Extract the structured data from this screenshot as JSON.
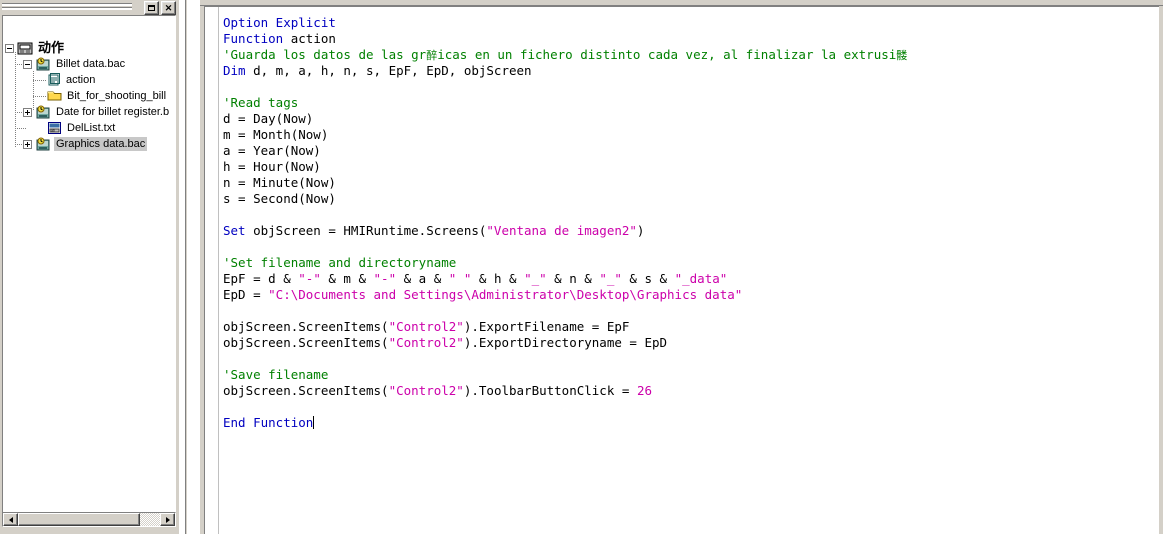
{
  "tree_window": {
    "titlebar": {
      "maximize_label": "□",
      "close_label": "✕"
    },
    "root": {
      "label": "动作",
      "icon": "action-script-icon",
      "expander": "minus"
    },
    "items": [
      {
        "label": "Billet data.bac",
        "icon": "bac-file-icon",
        "expander": "minus",
        "depth": 1,
        "selected": false
      },
      {
        "label": "action",
        "icon": "function-icon",
        "expander": "none",
        "depth": 2,
        "selected": false
      },
      {
        "label": "Bit_for_shooting_bill",
        "icon": "folder-icon",
        "expander": "none",
        "depth": 2,
        "selected": false
      },
      {
        "label": "Date for billet register.b",
        "icon": "bac-file-icon",
        "expander": "plus",
        "depth": 1,
        "selected": false
      },
      {
        "label": "DelList.txt",
        "icon": "text-file-icon",
        "expander": "none",
        "depth": 1,
        "selected": false
      },
      {
        "label": "Graphics data.bac",
        "icon": "bac-file-icon",
        "expander": "plus",
        "depth": 1,
        "selected": true
      }
    ],
    "hscrollbar": {
      "left_arrow": "◄",
      "right_arrow": "►"
    }
  },
  "editor": {
    "lines": [
      {
        "segments": [
          {
            "t": "Option Explicit",
            "c": "kw"
          }
        ]
      },
      {
        "segments": [
          {
            "t": "Function",
            "c": "kw"
          },
          {
            "t": " action",
            "c": ""
          }
        ]
      },
      {
        "segments": [
          {
            "t": "'Guarda los datos de las gr",
            "c": "cm"
          },
          {
            "t": "醉",
            "c": "mojibake"
          },
          {
            "t": "icas en un fichero distinto cada vez, al finalizar la extrusi",
            "c": "cm"
          },
          {
            "t": "髅",
            "c": "mojibake"
          }
        ]
      },
      {
        "segments": [
          {
            "t": "Dim",
            "c": "kw"
          },
          {
            "t": " d, m, a, h, n, s, EpF, EpD, objScreen",
            "c": ""
          }
        ]
      },
      {
        "segments": []
      },
      {
        "segments": [
          {
            "t": "'Read tags",
            "c": "cm"
          }
        ]
      },
      {
        "segments": [
          {
            "t": "d = Day(Now)",
            "c": ""
          }
        ]
      },
      {
        "segments": [
          {
            "t": "m = Month(Now)",
            "c": ""
          }
        ]
      },
      {
        "segments": [
          {
            "t": "a = Year(Now)",
            "c": ""
          }
        ]
      },
      {
        "segments": [
          {
            "t": "h = Hour(Now)",
            "c": ""
          }
        ]
      },
      {
        "segments": [
          {
            "t": "n = Minute(Now)",
            "c": ""
          }
        ]
      },
      {
        "segments": [
          {
            "t": "s = Second(Now)",
            "c": ""
          }
        ]
      },
      {
        "segments": []
      },
      {
        "segments": [
          {
            "t": "Set",
            "c": "kw"
          },
          {
            "t": " objScreen = HMIRuntime.Screens(",
            "c": ""
          },
          {
            "t": "\"Ventana de imagen2\"",
            "c": "str"
          },
          {
            "t": ")",
            "c": ""
          }
        ]
      },
      {
        "segments": []
      },
      {
        "segments": [
          {
            "t": "'Set filename and directoryname",
            "c": "cm"
          }
        ]
      },
      {
        "segments": [
          {
            "t": "EpF = d & ",
            "c": ""
          },
          {
            "t": "\"-\"",
            "c": "str"
          },
          {
            "t": " & m & ",
            "c": ""
          },
          {
            "t": "\"-\"",
            "c": "str"
          },
          {
            "t": " & a & ",
            "c": ""
          },
          {
            "t": "\" \"",
            "c": "str"
          },
          {
            "t": " & h & ",
            "c": ""
          },
          {
            "t": "\"_\"",
            "c": "str"
          },
          {
            "t": " & n & ",
            "c": ""
          },
          {
            "t": "\"_\"",
            "c": "str"
          },
          {
            "t": " & s & ",
            "c": ""
          },
          {
            "t": "\"_data\"",
            "c": "str"
          }
        ]
      },
      {
        "segments": [
          {
            "t": "EpD = ",
            "c": ""
          },
          {
            "t": "\"C:\\Documents and Settings\\Administrator\\Desktop\\Graphics data\"",
            "c": "str"
          }
        ]
      },
      {
        "segments": []
      },
      {
        "segments": [
          {
            "t": "objScreen.ScreenItems(",
            "c": ""
          },
          {
            "t": "\"Control2\"",
            "c": "str"
          },
          {
            "t": ").ExportFilename = EpF",
            "c": ""
          }
        ]
      },
      {
        "segments": [
          {
            "t": "objScreen.ScreenItems(",
            "c": ""
          },
          {
            "t": "\"Control2\"",
            "c": "str"
          },
          {
            "t": ").ExportDirectoryname = EpD",
            "c": ""
          }
        ]
      },
      {
        "segments": []
      },
      {
        "segments": [
          {
            "t": "'Save filename",
            "c": "cm"
          }
        ]
      },
      {
        "segments": [
          {
            "t": "objScreen.ScreenItems(",
            "c": ""
          },
          {
            "t": "\"Control2\"",
            "c": "str"
          },
          {
            "t": ").ToolbarButtonClick = ",
            "c": ""
          },
          {
            "t": "26",
            "c": "num"
          }
        ]
      },
      {
        "segments": []
      },
      {
        "segments": [
          {
            "t": "End Function",
            "c": "kw"
          },
          {
            "t": "|CARET|",
            "c": "caret"
          }
        ]
      }
    ]
  },
  "colors": {
    "keyword": "#0000c0",
    "comment": "#008000",
    "string": "#cc00aa",
    "text": "#000000",
    "window_face": "#d4d0c8",
    "selection": "#c8c8c8"
  }
}
